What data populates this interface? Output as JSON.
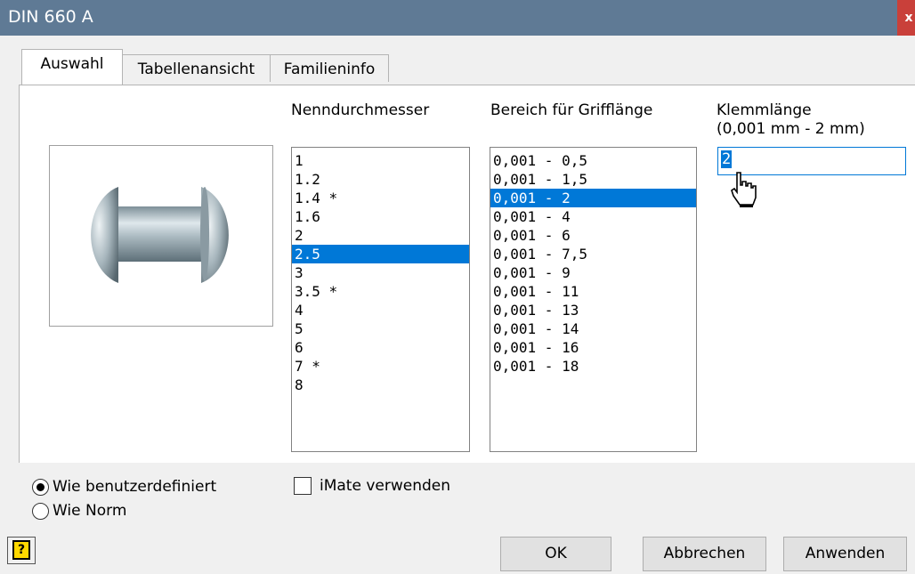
{
  "window": {
    "title": "DIN 660 A",
    "close_label": "x"
  },
  "tabs": [
    {
      "label": "Auswahl",
      "active": true
    },
    {
      "label": "Tabellenansicht",
      "active": false
    },
    {
      "label": "Familieninfo",
      "active": false
    }
  ],
  "columns": {
    "nenndurchmesser": {
      "header": "Nenndurchmesser",
      "items": [
        "1",
        "1.2",
        "1.4 *",
        "1.6",
        "2",
        "2.5",
        "3",
        "3.5 *",
        "4",
        "5",
        "6",
        "7 *",
        "8"
      ],
      "selected": "2.5"
    },
    "grifflaenge": {
      "header": "Bereich für Grifflänge",
      "items": [
        "0,001 - 0,5",
        "0,001 - 1,5",
        "0,001 - 2",
        "0,001 - 4",
        "0,001 - 6",
        "0,001 - 7,5",
        "0,001 - 9",
        "0,001 - 11",
        "0,001 - 13",
        "0,001 - 14",
        "0,001 - 16",
        "0,001 - 18"
      ],
      "selected": "0,001 - 2"
    },
    "klemmlaenge": {
      "header_line1": "Klemmlänge",
      "header_line2": "(0,001 mm - 2 mm)",
      "value": "2"
    }
  },
  "options": {
    "radio_user": "Wie benutzerdefiniert",
    "radio_norm": "Wie Norm",
    "radio_selected": "user",
    "imate_label": "iMate verwenden",
    "imate_checked": false
  },
  "buttons": {
    "ok": "OK",
    "cancel": "Abbrechen",
    "apply": "Anwenden",
    "help_glyph": "?"
  },
  "colors": {
    "titlebar": "#5f7a95",
    "close": "#c9403a",
    "selection": "#0078d7"
  },
  "icons": {
    "preview": "rivet-image",
    "help": "help-icon",
    "cursor": "hand-cursor-icon"
  }
}
